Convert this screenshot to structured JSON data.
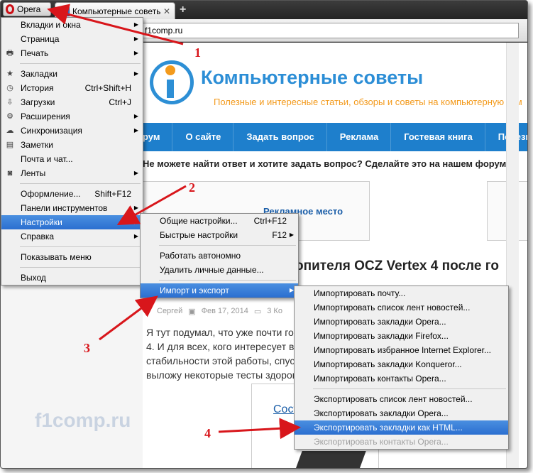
{
  "browser": {
    "opera_label": "Opera",
    "tab_title": "Компьютерные советы",
    "tab_close": "✕",
    "new_tab": "+",
    "url": "f1comp.ru"
  },
  "site": {
    "title": "Компьютерные советы",
    "subtitle": "Полезные и интересные статьи, обзоры и советы на компьютерную тем",
    "nav": [
      "рум",
      "О сайте",
      "Задать вопрос",
      "Реклама",
      "Гостевая книга",
      "Полезные прог"
    ],
    "notice": "Не можете найти ответ и хотите задать вопрос? Сделайте это на нашем форуме",
    "ad": "Рекламное место",
    "headline": "опителя OCZ Vertex 4 после го",
    "meta_author": "Сергей",
    "meta_date": "Фев 17, 2014",
    "meta_comments": "3 Ко",
    "para": [
      "Я тут подумал, что уже почти го                                           тел",
      "4. И для всех, кого интересует в                                           на",
      "стабильности этой работы, спус                                              ь,",
      "выложу некоторые тесты здоров"
    ],
    "image_text": "Сост",
    "watermark": "f1comp.ru"
  },
  "menu_main": [
    {
      "label": "Вкладки и окна",
      "arrow": "▶",
      "icon": ""
    },
    {
      "label": "Страница",
      "arrow": "▶",
      "icon": ""
    },
    {
      "label": "Печать",
      "arrow": "▶",
      "icon": "🖶"
    },
    {
      "sep": true
    },
    {
      "label": "Закладки",
      "arrow": "▶",
      "icon": "★"
    },
    {
      "label": "История",
      "shortcut": "Ctrl+Shift+H",
      "icon": "◷"
    },
    {
      "label": "Загрузки",
      "shortcut": "Ctrl+J",
      "icon": "⇩"
    },
    {
      "label": "Расширения",
      "arrow": "▶",
      "icon": "⚙"
    },
    {
      "label": "Синхронизация",
      "arrow": "▶",
      "icon": "☁"
    },
    {
      "label": "Заметки",
      "icon": "▤"
    },
    {
      "label": "Почта и чат...",
      "icon": ""
    },
    {
      "label": "Ленты",
      "arrow": "▶",
      "icon": "◙"
    },
    {
      "sep": true
    },
    {
      "label": "Оформление...",
      "shortcut": "Shift+F12",
      "icon": ""
    },
    {
      "label": "Панели инструментов",
      "arrow": "▶",
      "icon": ""
    },
    {
      "label": "Настройки",
      "arrow": "▶",
      "icon": "",
      "selected": true
    },
    {
      "label": "Справка",
      "arrow": "▶",
      "icon": ""
    },
    {
      "sep": true
    },
    {
      "label": "Показывать меню",
      "icon": ""
    },
    {
      "sep": true
    },
    {
      "label": "Выход",
      "icon": ""
    }
  ],
  "menu_settings": [
    {
      "label": "Общие настройки...",
      "shortcut": "Ctrl+F12"
    },
    {
      "label": "Быстрые настройки",
      "shortcut": "F12",
      "arrow": "▶"
    },
    {
      "sep": true
    },
    {
      "label": "Работать автономно"
    },
    {
      "label": "Удалить личные данные..."
    },
    {
      "sep": true
    },
    {
      "label": "Импорт и экспорт",
      "arrow": "▶",
      "selected": true
    }
  ],
  "menu_import": [
    {
      "label": "Импортировать почту..."
    },
    {
      "label": "Импортировать список лент новостей..."
    },
    {
      "label": "Импортировать закладки Opera..."
    },
    {
      "label": "Импортировать закладки Firefox..."
    },
    {
      "label": "Импортировать избранное Internet Explorer..."
    },
    {
      "label": "Импортировать закладки Konqueror..."
    },
    {
      "label": "Импортировать контакты Opera..."
    },
    {
      "sep": true
    },
    {
      "label": "Экспортировать список лент новостей..."
    },
    {
      "label": "Экспортировать закладки Opera..."
    },
    {
      "label": "Экспортировать закладки как HTML...",
      "selected": true
    },
    {
      "label": "Экспортировать контакты Opera...",
      "disabled": true
    }
  ],
  "annotations": {
    "n1": "1",
    "n2": "2",
    "n3": "3",
    "n4": "4",
    "color": "#d8161b"
  }
}
